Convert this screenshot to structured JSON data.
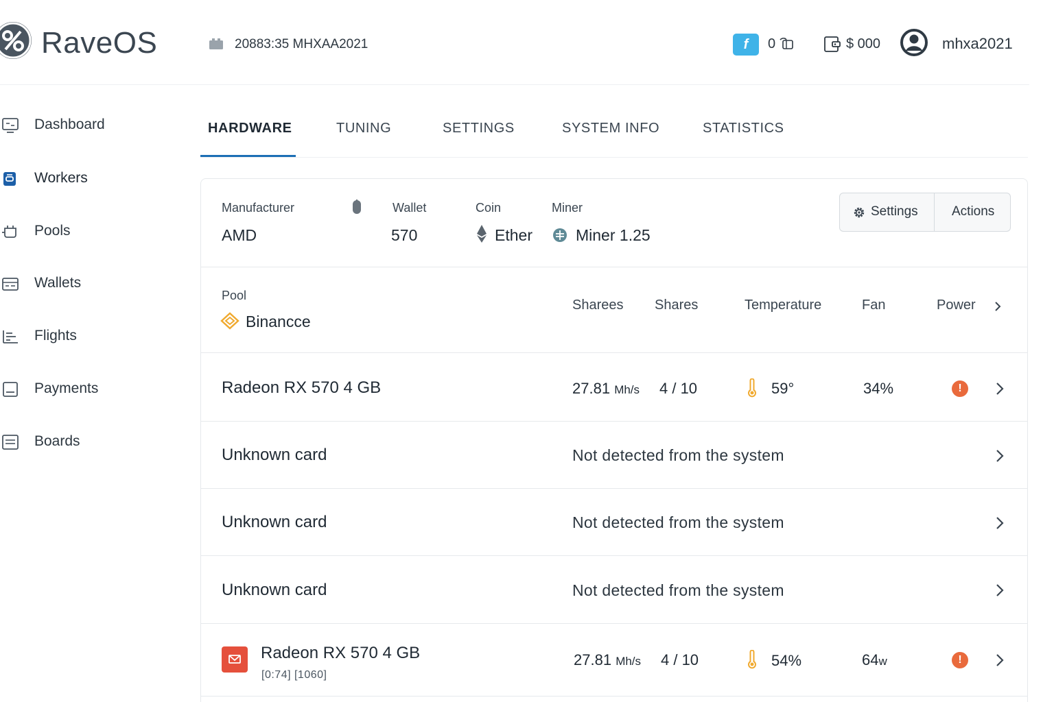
{
  "header": {
    "brand": "RaveOS",
    "worker_id": "20883:35 MHXAA2021",
    "flux_badge": "f",
    "flux_count": "0",
    "balance": "$ 000",
    "username": "mhxa2021"
  },
  "sidebar": {
    "items": [
      {
        "label": "Dashboard",
        "icon": "monitor-icon"
      },
      {
        "label": "Workers",
        "icon": "worker-icon",
        "active": true
      },
      {
        "label": "Pools",
        "icon": "pool-icon"
      },
      {
        "label": "Wallets",
        "icon": "wallet-icon"
      },
      {
        "label": "Flights",
        "icon": "flights-icon"
      },
      {
        "label": "Payments",
        "icon": "payments-icon"
      },
      {
        "label": "Boards",
        "icon": "boards-icon"
      }
    ]
  },
  "tabs": [
    {
      "label": "HARDWARE",
      "active": true
    },
    {
      "label": "TUNING"
    },
    {
      "label": "SETTINGS"
    },
    {
      "label": "SYSTEM INFO"
    },
    {
      "label": "STATISTICS"
    }
  ],
  "meta": {
    "manufacturer_label": "Manufacturer",
    "manufacturer_value": "AMD",
    "wallet_label": "Wallet",
    "wallet_value": "570",
    "coin_label": "Coin",
    "coin_value": "Ether",
    "miner_label": "Miner",
    "miner_value": "Miner 1.25",
    "pool_label": "Pool",
    "pool_value": "Binancce"
  },
  "buttons": {
    "settings": "Settings",
    "actions": "Actions"
  },
  "columns": {
    "sharees": "Sharees",
    "shares": "Shares",
    "temperature": "Temperature",
    "fan": "Fan",
    "power": "Power"
  },
  "gpus": [
    {
      "name": "Radeon RX 570 4 GB",
      "hashrate": "27.81",
      "unit": "Mh/s",
      "shares": "4 / 10",
      "temp": "59°",
      "fan": "34%",
      "warning": "!"
    },
    {
      "name": "Unknown card",
      "status": "Not detected from the system"
    },
    {
      "name": "Unknown card",
      "status": "Not detected from the system"
    },
    {
      "name": "Unknown card",
      "status": "Not detected from the system"
    },
    {
      "name": "Radeon RX 570 4 GB",
      "sub": "[0:74]  [1060]",
      "hashrate": "27.81",
      "unit": "Mh/s",
      "shares": "4 / 10",
      "temp": "54%",
      "power_value": "64",
      "power_unit": "w",
      "warning": "!"
    }
  ],
  "colors": {
    "accent": "#1c6fb5",
    "flux": "#3fb3e8",
    "warning": "#e96a3c",
    "thermo": "#f0a92e"
  }
}
